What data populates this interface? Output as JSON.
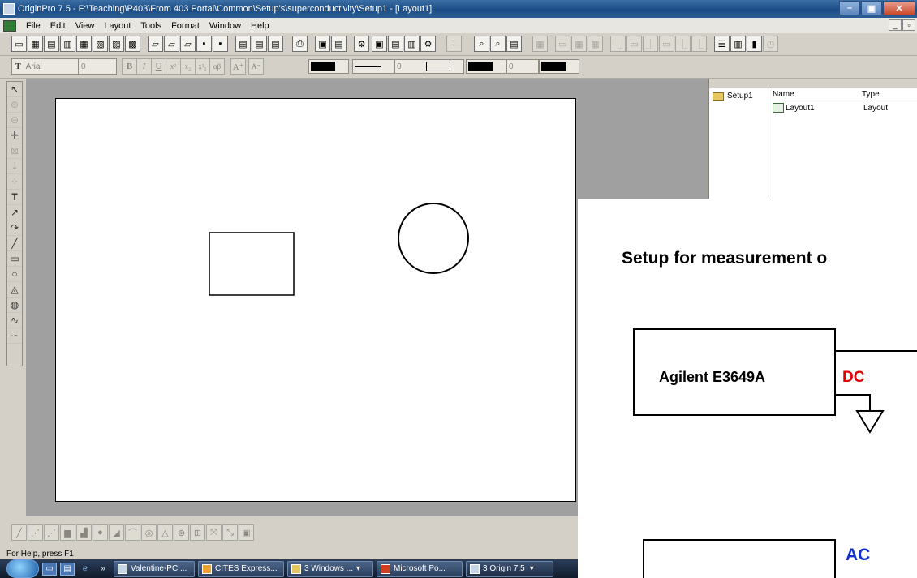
{
  "window": {
    "title": "OriginPro 7.5 - F:\\Teaching\\P403\\From 403 Portal\\Common\\Setup's\\superconductivity\\Setup1 - [Layout1]"
  },
  "menu": [
    "File",
    "Edit",
    "View",
    "Layout",
    "Tools",
    "Format",
    "Window",
    "Help"
  ],
  "format_toolbar": {
    "font": "Arial",
    "font_size": "0",
    "bold": "B",
    "italic": "I",
    "underline": "U",
    "superscript": "x²",
    "subscript": "x₂",
    "supersub": "x²₁",
    "greek": "αβ",
    "grow_font": "A⁺",
    "shrink_font": "A⁻",
    "line_width": "0",
    "line_width_2": "0"
  },
  "project_explorer": {
    "folder": "Setup1",
    "columns": [
      "Name",
      "Type"
    ],
    "items": [
      {
        "name": "Layout1",
        "type": "Layout"
      }
    ]
  },
  "status": "For Help, press F1",
  "taskbar": {
    "tasks": [
      "Valentine-PC ...",
      "CITES Express...",
      "3 Windows ...",
      "Microsoft Po...",
      "3 Origin 7.5"
    ]
  },
  "slide": {
    "title": "Setup for measurement o",
    "instrument": "Agilent E3649A",
    "dc": "DC",
    "ac": "AC"
  },
  "colors": {
    "dc": "#e00000",
    "ac": "#1030c8",
    "titlebar": "#1c4d86"
  }
}
